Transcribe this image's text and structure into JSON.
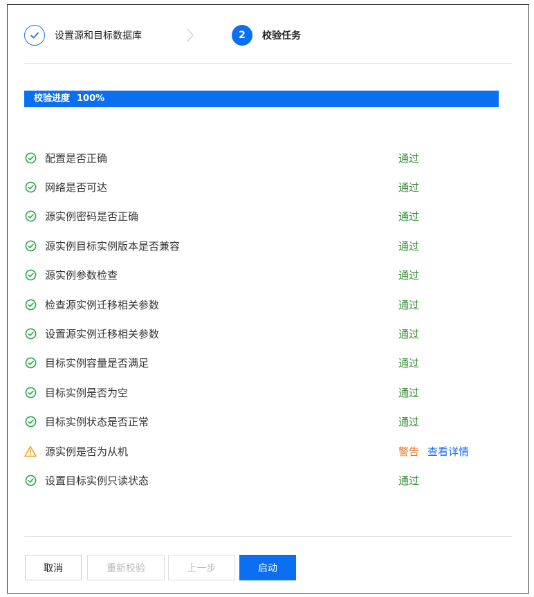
{
  "steps": [
    {
      "label": "设置源和目标数据库",
      "state": "done"
    },
    {
      "number": "2",
      "label": "校验任务",
      "state": "active"
    }
  ],
  "progress": {
    "label": "校验进度",
    "value_text": "100%",
    "value": 100
  },
  "checks": [
    {
      "name": "配置是否正确",
      "status": "通过",
      "result": "pass"
    },
    {
      "name": "网络是否可达",
      "status": "通过",
      "result": "pass"
    },
    {
      "name": "源实例密码是否正确",
      "status": "通过",
      "result": "pass"
    },
    {
      "name": "源实例目标实例版本是否兼容",
      "status": "通过",
      "result": "pass"
    },
    {
      "name": "源实例参数检查",
      "status": "通过",
      "result": "pass"
    },
    {
      "name": "检查源实例迁移相关参数",
      "status": "通过",
      "result": "pass"
    },
    {
      "name": "设置源实例迁移相关参数",
      "status": "通过",
      "result": "pass"
    },
    {
      "name": "目标实例容量是否满足",
      "status": "通过",
      "result": "pass"
    },
    {
      "name": "目标实例是否为空",
      "status": "通过",
      "result": "pass"
    },
    {
      "name": "目标实例状态是否正常",
      "status": "通过",
      "result": "pass"
    },
    {
      "name": "源实例是否为从机",
      "status": "警告",
      "result": "warning",
      "link": "查看详情"
    },
    {
      "name": "设置目标实例只读状态",
      "status": "通过",
      "result": "pass"
    }
  ],
  "buttons": {
    "cancel": "取消",
    "recheck": "重新校验",
    "prev": "上一步",
    "start": "启动"
  },
  "colors": {
    "primary": "#0b6ff2",
    "pass": "#2e8b2e",
    "warning": "#e5731f",
    "pass_icon": "#27a745",
    "warning_icon": "#f0a020"
  }
}
